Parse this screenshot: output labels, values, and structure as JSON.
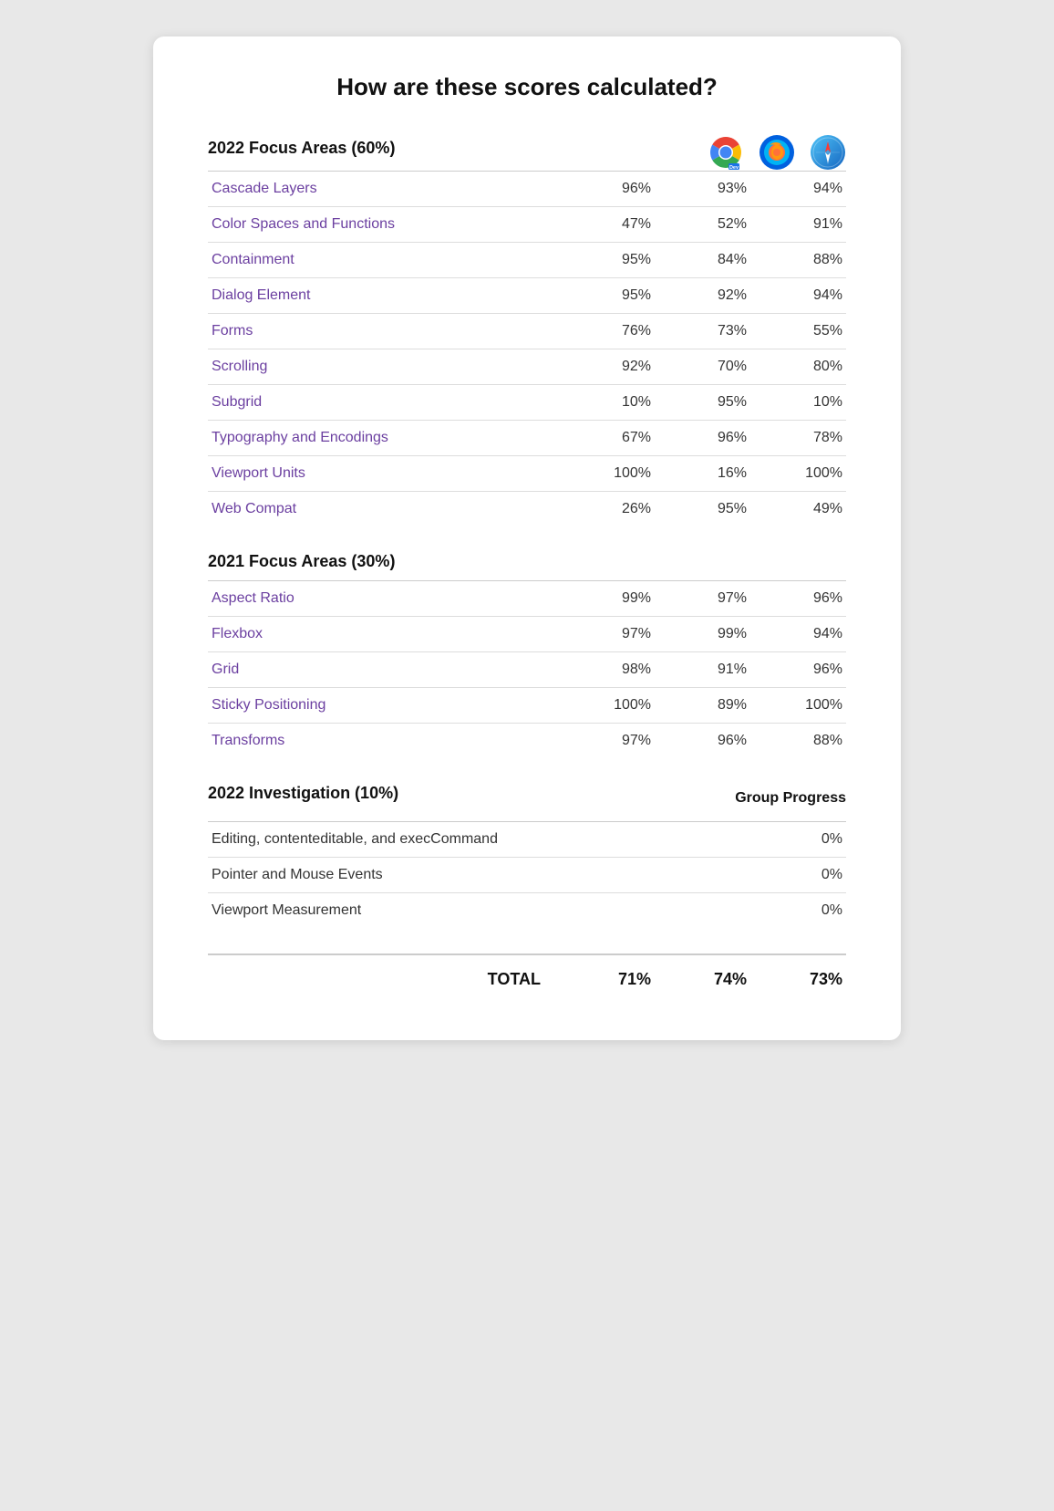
{
  "title": "How are these scores calculated?",
  "section2022": {
    "label": "2022 Focus Areas (60%)",
    "rows": [
      {
        "name": "Cascade Layers",
        "chrome": "96%",
        "firefox": "93%",
        "safari": "94%"
      },
      {
        "name": "Color Spaces and Functions",
        "chrome": "47%",
        "firefox": "52%",
        "safari": "91%"
      },
      {
        "name": "Containment",
        "chrome": "95%",
        "firefox": "84%",
        "safari": "88%"
      },
      {
        "name": "Dialog Element",
        "chrome": "95%",
        "firefox": "92%",
        "safari": "94%"
      },
      {
        "name": "Forms",
        "chrome": "76%",
        "firefox": "73%",
        "safari": "55%"
      },
      {
        "name": "Scrolling",
        "chrome": "92%",
        "firefox": "70%",
        "safari": "80%"
      },
      {
        "name": "Subgrid",
        "chrome": "10%",
        "firefox": "95%",
        "safari": "10%"
      },
      {
        "name": "Typography and Encodings",
        "chrome": "67%",
        "firefox": "96%",
        "safari": "78%"
      },
      {
        "name": "Viewport Units",
        "chrome": "100%",
        "firefox": "16%",
        "safari": "100%"
      },
      {
        "name": "Web Compat",
        "chrome": "26%",
        "firefox": "95%",
        "safari": "49%"
      }
    ]
  },
  "section2021": {
    "label": "2021 Focus Areas (30%)",
    "rows": [
      {
        "name": "Aspect Ratio",
        "chrome": "99%",
        "firefox": "97%",
        "safari": "96%"
      },
      {
        "name": "Flexbox",
        "chrome": "97%",
        "firefox": "99%",
        "safari": "94%"
      },
      {
        "name": "Grid",
        "chrome": "98%",
        "firefox": "91%",
        "safari": "96%"
      },
      {
        "name": "Sticky Positioning",
        "chrome": "100%",
        "firefox": "89%",
        "safari": "100%"
      },
      {
        "name": "Transforms",
        "chrome": "97%",
        "firefox": "96%",
        "safari": "88%"
      }
    ]
  },
  "sectionInvestigation": {
    "label": "2022 Investigation (10%)",
    "group_progress_label": "Group Progress",
    "rows": [
      {
        "name": "Editing, contenteditable, and execCommand",
        "value": "0%"
      },
      {
        "name": "Pointer and Mouse Events",
        "value": "0%"
      },
      {
        "name": "Viewport Measurement",
        "value": "0%"
      }
    ]
  },
  "total": {
    "label": "TOTAL",
    "chrome": "71%",
    "firefox": "74%",
    "safari": "73%"
  }
}
